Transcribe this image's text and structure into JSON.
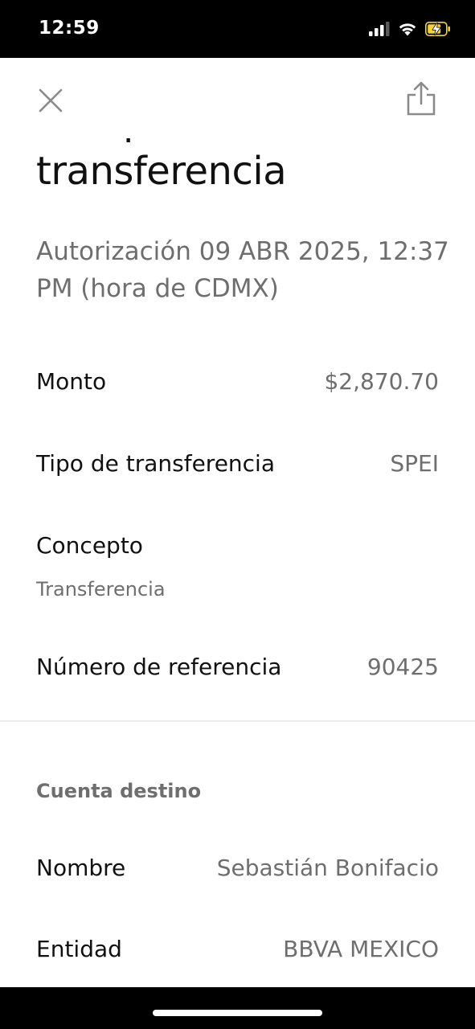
{
  "status_bar": {
    "time": "12:59",
    "icons": [
      "cellular-signal-icon",
      "wifi-icon",
      "battery-charging-icon"
    ]
  },
  "nav": {
    "close_icon": "close-icon",
    "share_icon": "share-icon"
  },
  "header": {
    "title": "Comprobante de transferencia",
    "subtitle": "Autorización 09 ABR 2025, 12:37 PM (hora de CDMX)"
  },
  "details": {
    "amount": {
      "label": "Monto",
      "value": "$2,870.70"
    },
    "transfer_type": {
      "label": "Tipo de transferencia",
      "value": "SPEI"
    },
    "concept": {
      "label": "Concepto",
      "value": "Transferencia"
    },
    "reference": {
      "label": "Número de referencia",
      "value": "90425"
    }
  },
  "destination": {
    "section_title": "Cuenta destino",
    "name": {
      "label": "Nombre",
      "value": "Sebastián Bonifacio"
    },
    "entity": {
      "label": "Entidad",
      "value": "BBVA MEXICO"
    }
  },
  "colors": {
    "primary_text": "#111111",
    "secondary_text": "#6e6e6e",
    "icon_gray": "#8a8a8a",
    "battery_charging": "#f4d03f"
  }
}
